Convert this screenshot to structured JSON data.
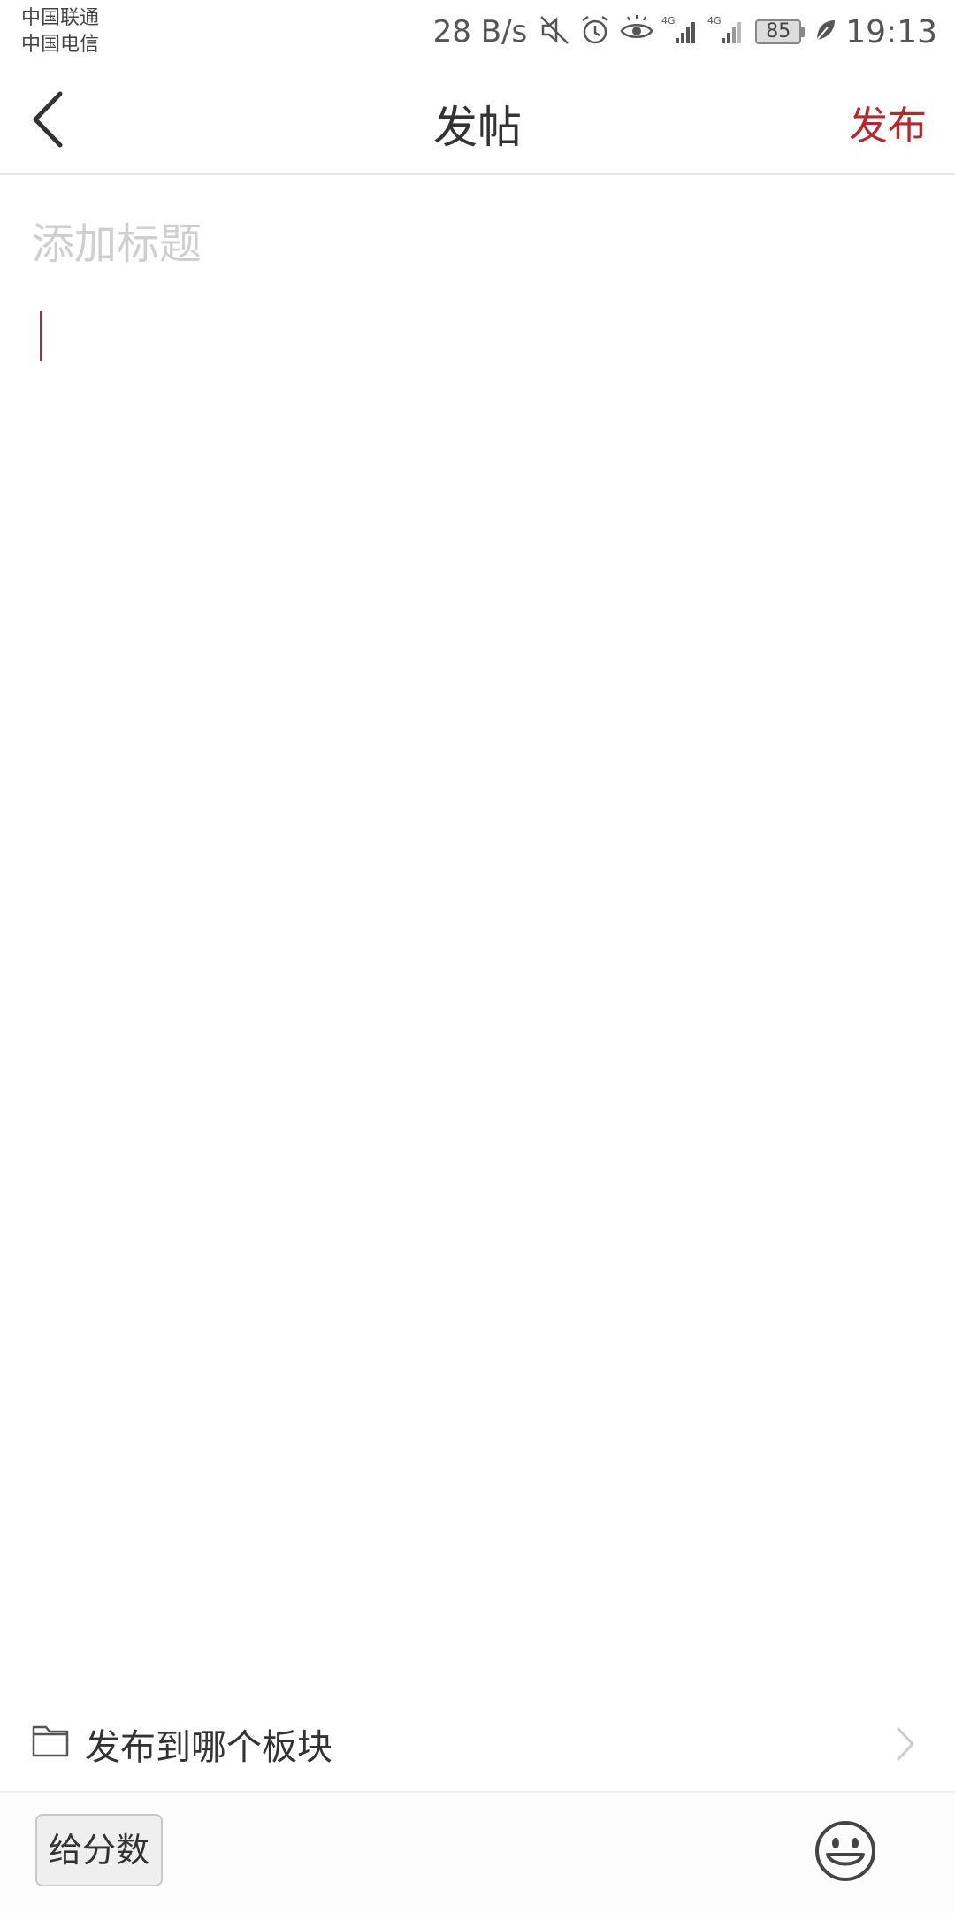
{
  "status_bar": {
    "carrier_1": "中国联通",
    "carrier_2": "中国电信",
    "net_speed": "28 B/s",
    "battery": "85",
    "time": "19:13",
    "icons": [
      "mute-icon",
      "alarm-icon",
      "eye-icon",
      "signal-4g-icon",
      "signal-4g-icon",
      "battery-icon",
      "leaf-icon"
    ]
  },
  "header": {
    "title": "发帖",
    "publish_label": "发布",
    "back_icon": "back-arrow-icon"
  },
  "editor": {
    "title_placeholder": "添加标题",
    "title_value": "",
    "content_value": ""
  },
  "board_selector": {
    "label": "发布到哪个板块",
    "icon": "folder-icon"
  },
  "bottom_bar": {
    "score_label": "给分数",
    "emoji_icon": "emoji-icon"
  },
  "colors": {
    "accent": "#b3292f",
    "text": "#333333",
    "placeholder": "#cfcfcf",
    "divider": "#e6e6e6"
  }
}
